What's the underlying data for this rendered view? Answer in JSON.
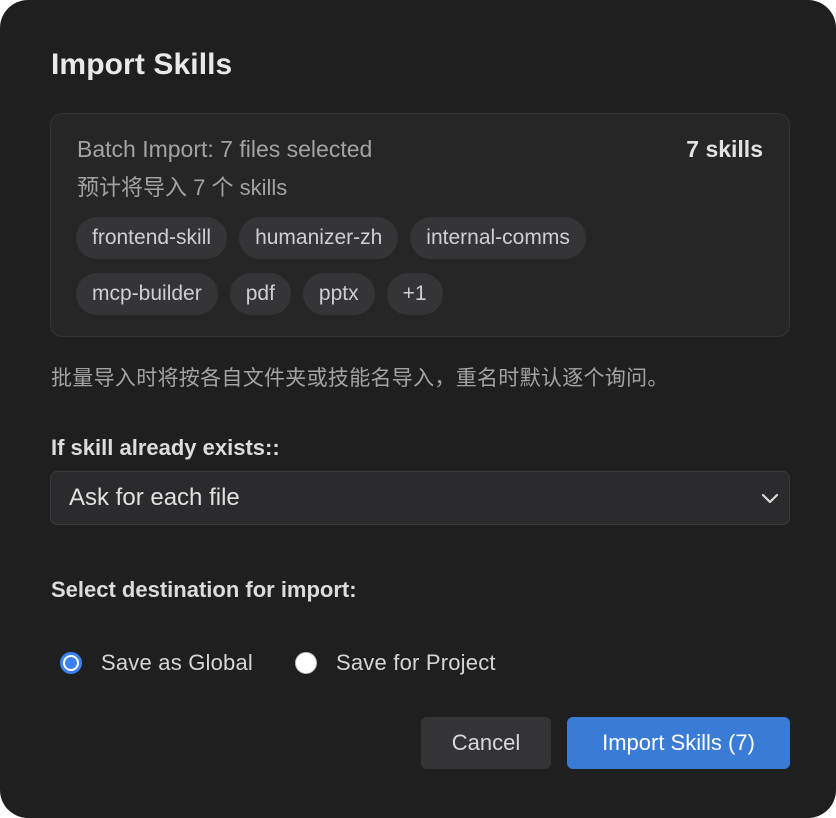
{
  "dialog": {
    "title": "Import Skills",
    "batch": {
      "summary": "Batch Import: 7 files selected",
      "estimate": "预计将导入 7 个 skills",
      "count_badge": "7 skills",
      "chips_row1": [
        "frontend-skill",
        "humanizer-zh",
        "internal-comms"
      ],
      "chips_row2": [
        "mcp-builder",
        "pdf",
        "pptx",
        "+1"
      ]
    },
    "note": "批量导入时将按各自文件夹或技能名导入，重名时默认逐个询问。",
    "exists_label": "If skill already exists::",
    "exists_select": {
      "value": "Ask for each file"
    },
    "destination_label": "Select destination for import:",
    "destination_options": [
      {
        "label": "Save as Global",
        "checked": true
      },
      {
        "label": "Save for Project",
        "checked": false
      }
    ],
    "buttons": {
      "cancel": "Cancel",
      "import": "Import Skills (7)"
    },
    "colors": {
      "background": "#1f1f20",
      "accent": "#3a7bd5",
      "radio_accent": "#3b82f6"
    }
  }
}
